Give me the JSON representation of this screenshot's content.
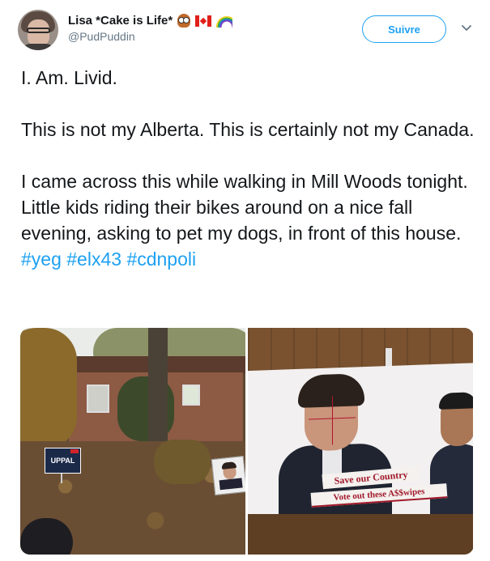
{
  "tweet": {
    "author": {
      "display_name": "Lisa *Cake is Life*",
      "handle": "@PudPuddin",
      "name_emojis": [
        "owl-emoji",
        "canada-flag-emoji",
        "rainbow-emoji"
      ]
    },
    "follow_button_label": "Suivre",
    "paragraphs": [
      {
        "text": "I. Am. Livid.",
        "hashtags": []
      },
      {
        "text": "This is not my Alberta. This is certainly not my Canada.",
        "hashtags": []
      },
      {
        "text": "I came across this while walking in Mill Woods tonight. Little kids riding their bikes around on a nice fall evening, asking to pet my dogs, in front of this house.",
        "hashtags": [
          "#yeg",
          "#elx43",
          "#cdnpoli"
        ]
      }
    ],
    "media": {
      "photo_left": {
        "yard_sign_text": "UPPAL"
      },
      "photo_right": {
        "poster_line1": "Save our Country",
        "poster_line2": "Vote out these A$$wipes"
      }
    }
  },
  "colors": {
    "link": "#1da1f2",
    "text": "#14171a",
    "secondary": "#657786"
  }
}
